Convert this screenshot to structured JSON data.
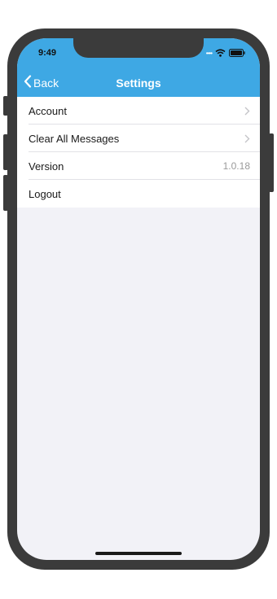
{
  "status_bar": {
    "time": "9:49",
    "signal_icon": "signal-dots-icon",
    "wifi_icon": "wifi-icon",
    "battery_icon": "battery-icon"
  },
  "nav": {
    "back_label": "Back",
    "back_icon": "chevron-left-icon",
    "title": "Settings",
    "bar_color": "#3ea8e4"
  },
  "settings": {
    "items": [
      {
        "label": "Account",
        "accessory": "chevron-right-icon"
      },
      {
        "label": "Clear All Messages",
        "accessory": "chevron-right-icon"
      },
      {
        "label": "Version",
        "value": "1.0.18"
      },
      {
        "label": "Logout"
      }
    ]
  }
}
